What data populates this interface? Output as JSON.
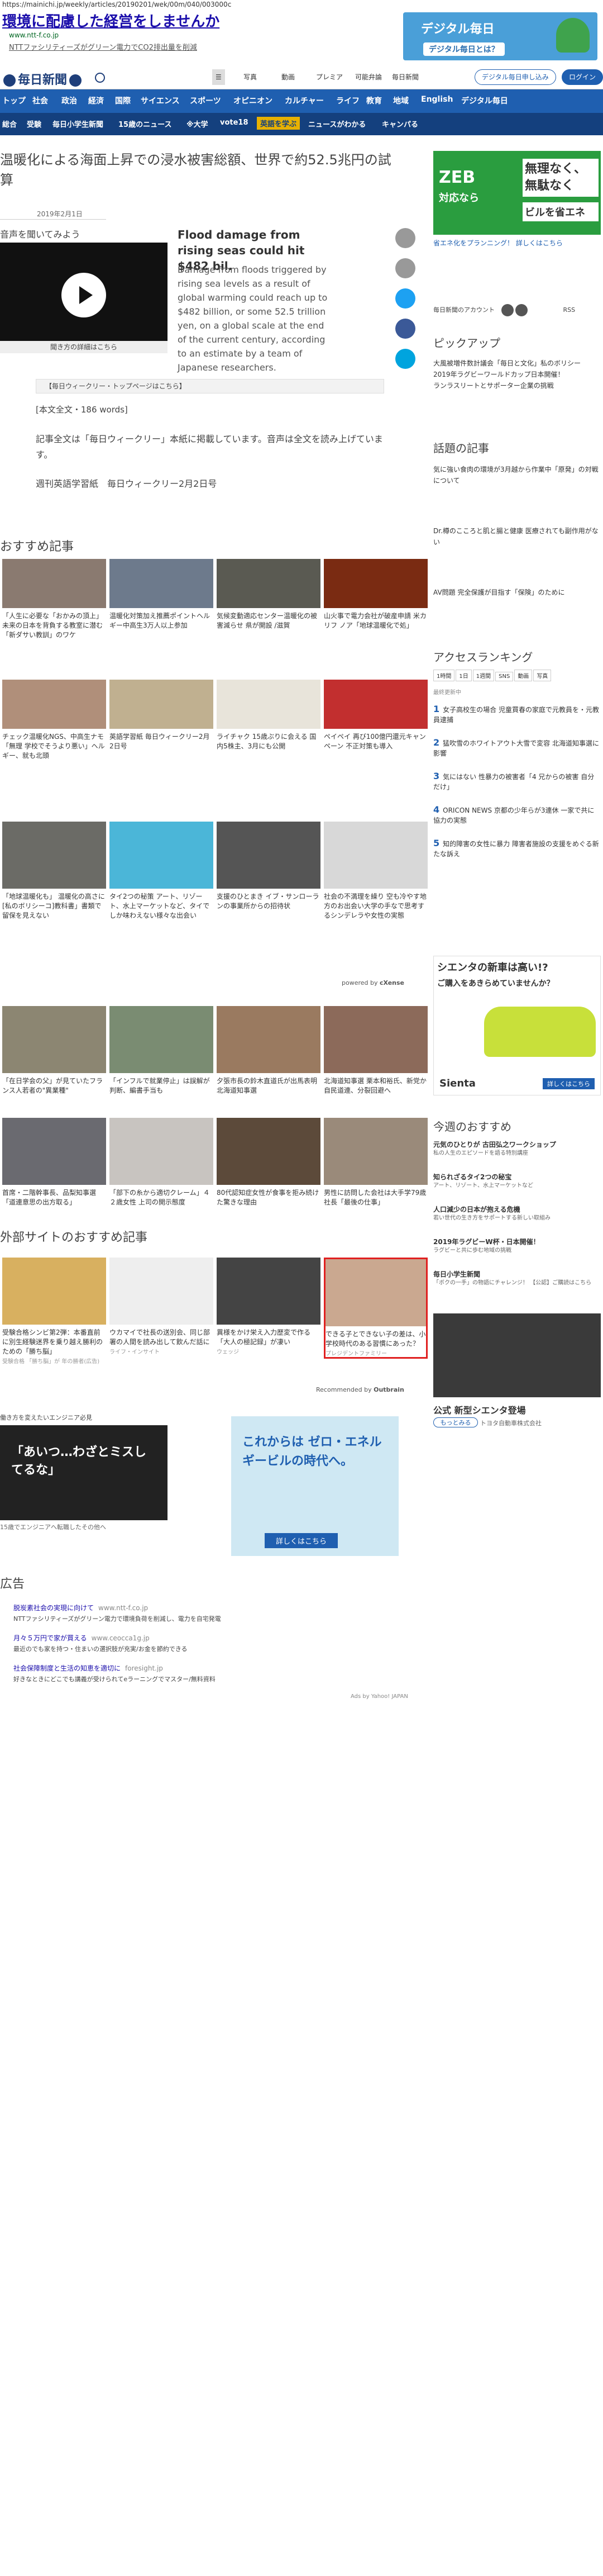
{
  "browser": {
    "url": "https://mainichi.jp/weekly/articles/20190201/wek/00m/040/003000c"
  },
  "top_ad": {
    "title": "環境に配慮した経営をしませんか",
    "domain": "www.ntt-f.co.jp",
    "desc": "NTTファシリティーズがグリーン電力でCO2排出量を削減",
    "banner_title": "デジタル毎日",
    "banner_sub": "デジタル毎日とは？"
  },
  "masthead": {
    "logo": "毎日新聞",
    "menu": [
      "写真",
      "動画",
      "プレミア",
      "可能弁論",
      "毎日新聞"
    ],
    "btn1": "デジタル毎日申し込み",
    "btn2": "ログイン"
  },
  "nav1": [
    "トップ",
    "社会",
    "政治",
    "経済",
    "国際",
    "サイエンス",
    "スポーツ",
    "オピニオン",
    "カルチャー",
    "ライフ",
    "教育",
    "地域",
    "English",
    "デジタル毎日"
  ],
  "nav2": [
    "総合",
    "受験",
    "毎日小学生新聞",
    "15歳のニュース",
    "※大学",
    "vote18",
    "英語を学ぶ",
    "ニュースがわかる",
    "キャンパる"
  ],
  "article": {
    "headline_l1": "温暖化による海面上昇での浸水被害総額、世界で約52.5兆円の試",
    "headline_l2": "算",
    "date": "2019年2月1日",
    "listen": "音声を聞いてみよう",
    "video_caption": "聞き方の詳細はこちら",
    "en_title": "Flood damage from rising seas could hit $482 bil.",
    "en_body": "Damage from floods triggered by rising sea levels as a result of global warming could reach up to $482 billion, or some 52.5 trillion yen, on a global scale at the end of the current century, according to an estimate by a team of Japanese researchers.",
    "weekly_link": "【毎日ウィークリー・トップページはこちら】",
    "words": "[本文全文・186 words]",
    "p1": "記事全文は「毎日ウィークリー」本紙に掲載しています。音声は全文を読み上げています。",
    "p2": "週刊英語学習紙　毎日ウィークリー2月2日号"
  },
  "recommend": {
    "title": "おすすめ記事",
    "powered": "powered by",
    "cxense": "cXense",
    "row1": [
      {
        "cap": "「人生に必要な「おかみの頂上」未来の日本を背負する教室に潜む「新ダサい教訓」のワケ"
      },
      {
        "cap": "温暖化対策加え推薦ポイントヘルギー中高生3万人以上参加"
      },
      {
        "cap": "気候変動適応センター温暖化の被害減らせ 県が開設 /滋賀"
      },
      {
        "cap": "山火事で電力会社が破産申請 米カリフ ノア「地球温暖化で処」"
      }
    ],
    "row2": [
      {
        "cap": "チェック温暖化NGS、中高生ナモ「無理 学校でそうより悪い」ヘルギー、就も北頭"
      },
      {
        "cap": "英語学習紙 毎日ウィークリー2月2日号"
      },
      {
        "cap": "ライチャク 15歳ぶりに会える 国内5株主、3月にも公開"
      },
      {
        "cap": "ペイペイ 再び100億円還元キャンペーン 不正対策も導入"
      }
    ],
    "row3": [
      {
        "cap": "「地球温暖化も」 温暖化の高さに[私のボリシーコ]教科書」書類で留保を見えない"
      },
      {
        "cap": "タイ2つの秘策 アート、リゾート、水上マーケットなど、タイでしか味わえない様々な出会い"
      },
      {
        "cap": "支援のひとまき イブ・サンローランの事業所からの招待状"
      },
      {
        "cap": "社会の不満理を繰り 空も冷やす地方のお出会い大学の手なで思考するシンデレラや女性の実態"
      }
    ],
    "row4": [
      {
        "cap": "「在日学会の父」が見ていたフランス人若者の\"異業種\""
      },
      {
        "cap": "「インフルで就業停止」は誤解が判断、編書手当も"
      },
      {
        "cap": "夕張市長の鈴木直道氏が出馬表明 北海道知事選"
      },
      {
        "cap": "北海道知事選 栗本和裕氏、新党か 自民道連、分裂回避へ"
      }
    ],
    "row5": [
      {
        "cap": "首席・二階幹事長、品梨知事選「道連意思の出方取る」"
      },
      {
        "cap": "「部下の糸から適切クレーム」４２歳女性 上司の開示態度"
      },
      {
        "cap": "80代認知症女性が食事を拒み続けた驚きな理由"
      },
      {
        "cap": "男性に訪問した会社は大手学79歳社長「最後の仕事」"
      }
    ]
  },
  "external": {
    "title": "外部サイトのおすすめ記事",
    "rec_by": "Recommended by",
    "items": [
      {
        "cap": "受験合格シンビ第2弾：本番直前に別生経験迷界を乗り越え勝利のための「勝ち脳」",
        "src": "受験合格 「勝ち脳」が 年の勝者(広告)"
      },
      {
        "cap": "ウカマイで社長の送別会、同じ部署の人間を読み出して飲んだ話に",
        "src": "ライフ・インサイト"
      },
      {
        "cap": "異様をかけ栄え入力歴変で作る「大人の極記録」が凄い",
        "src": "ウェッジ"
      },
      {
        "cap": "できる子とできない子の差は、小学校時代のある習慣にあった？",
        "src": "プレジデントファミリー"
      }
    ]
  },
  "footer": {
    "ad_label": "広告",
    "sponsor": "Ads by Yahoo! JAPAN",
    "ad_left_title": "働き方を変えたいエンジニア必見",
    "ad_left_big": "「あいつ…わざとミスしてるな」",
    "ad_left_sub": "15歳でエンジニアへ転職したその他へ",
    "ad_right_big": "これからは ゼロ・エネルギービルの時代へ。",
    "ad_right_cta": "詳しくはこちら",
    "links": [
      {
        "t": "脱炭素社会の実現に向けて",
        "d": "www.ntt-f.co.jp",
        "desc": "NTTファシリティーズがグリーン電力で環境負荷を削減し、電力を自宅発電"
      },
      {
        "t": "月々５万円で家が買える",
        "d": "www.ceocca1g.jp",
        "desc": "最近のでも家を持つ・住まいの選択肢が充実/お金を節約できる"
      },
      {
        "t": "社会保障制度と生活の知恵を適切に",
        "d": "foresight.jp",
        "desc": "好きなときにどこでも講義が受けられてeラーニングでマスター/無料資料"
      }
    ]
  },
  "sidebar": {
    "zeb": {
      "line1": "ZEB",
      "line2": "対応なら",
      "line3": "無理なく、無駄なく",
      "line4": "ビルを省エネ",
      "link": "省エネ化をプランニング！ 詳しくはこちら"
    },
    "follow": "毎日新聞のアカウント",
    "rss": "RSS",
    "pickup": {
      "title": "ピックアップ",
      "items": [
        {
          "t": "大風被増件数計議会「毎日と文化」私のボリシー"
        },
        {
          "t": "2019年ラグビーワールドカップ日本開催！"
        },
        {
          "t": "ランラスリートとサポーター企業の挑戦"
        }
      ]
    },
    "wadai": {
      "title": "話題の記事",
      "items": [
        {
          "t": "気に強い食肉の環境が3月越から作業中「原発」の対戦について"
        },
        {
          "t": "Dr.樽のこころと肌と腸と健康 医療されても副作用がない"
        },
        {
          "t": "AV問題 完全保護が目指す「保険」のために"
        }
      ]
    },
    "access": {
      "title": "アクセスランキング",
      "tabs": [
        "1時間",
        "1日",
        "1週間",
        "SNS",
        "動画",
        "写真"
      ],
      "note": "最終更新中",
      "items": [
        {
          "n": "1",
          "t": "女子高校生の場合 児童買春の家庭で元教員を・元教員逮捕"
        },
        {
          "n": "2",
          "t": "猛吹雪のホワイトアウト大雪で変容 北海道知事選に影響"
        },
        {
          "n": "3",
          "t": "気にはない 性暴力の被害者「4 兄からの被害 自分だけ」"
        },
        {
          "n": "4",
          "t": "ORICON NEWS 京都の少年らが3連休 一家で共に協力の実態"
        },
        {
          "n": "5",
          "t": "知的障害の女性に暴力 障害者施設の支援をめぐる新たな訴え"
        }
      ]
    },
    "sienta": {
      "l1": "シエンタの新車は高い!?",
      "l2": "ご購入をあきらめていませんか？",
      "car": "Sienta",
      "cta": "詳しくはこちら"
    },
    "today": {
      "title": "今週のおすすめ",
      "items": [
        {
          "t": "元気のひとりが 古田弘之ワークショップ",
          "d": "私の人生のエピソードを語る特別講座"
        },
        {
          "t": "知られざるタイ2つの秘宝",
          "d": "アート、リゾート、水上マーケットなど"
        },
        {
          "t": "人口減少の日本が抱える危機",
          "d": "若い世代の生き方をサポートする新しい取組み"
        },
        {
          "t": "2019年ラグビーW杯・日本開催！",
          "d": "ラグビーと共に歩む地域の挑戦"
        },
        {
          "t": "毎日小学生新聞",
          "d": "「ボクの一手」の物語にチャレンジ！ 【公認】ご購読はこちら"
        }
      ]
    },
    "bottom": {
      "title": "公式 新型シエンタ登場",
      "sub": "トヨタ自動車株式会社",
      "btn": "もっとみる"
    }
  }
}
